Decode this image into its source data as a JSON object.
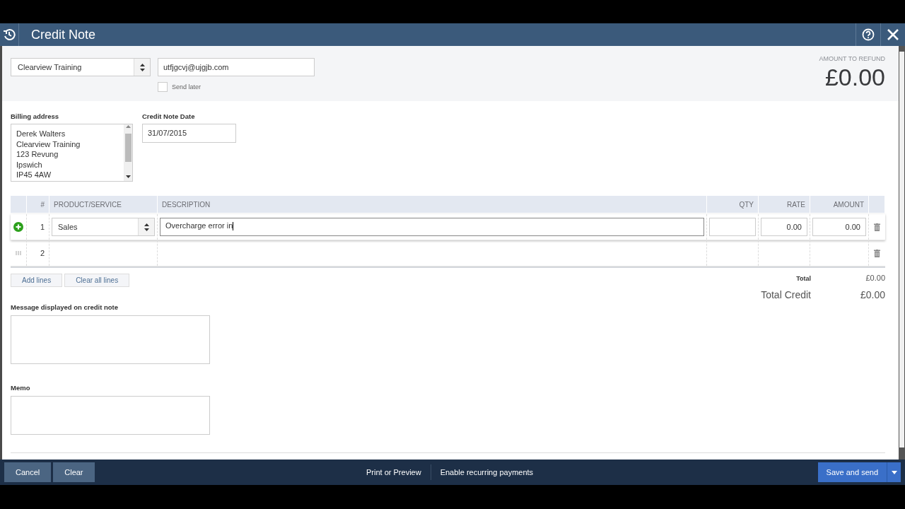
{
  "window": {
    "title": "Credit Note"
  },
  "customer": {
    "value": "Clearview Training"
  },
  "email": {
    "value": "utfjgcvj@ujgjb.com"
  },
  "send_later": {
    "label": "Send later",
    "checked": false
  },
  "amount_to_refund": {
    "label": "AMOUNT TO REFUND",
    "value": "£0.00"
  },
  "billing_address": {
    "label": "Billing address",
    "lines": [
      "Derek Walters",
      "Clearview Training",
      "123 Revung",
      "Ipswich",
      "IP45 4AW"
    ]
  },
  "credit_note_date": {
    "label": "Credit Note Date",
    "value": "31/07/2015"
  },
  "table": {
    "columns": [
      "#",
      "PRODUCT/SERVICE",
      "DESCRIPTION",
      "QTY",
      "RATE",
      "AMOUNT"
    ],
    "rows": [
      {
        "number": "1",
        "editing": true,
        "product": "Sales",
        "description": "Overcharge error in",
        "rate": "0.00",
        "amount": "0.00"
      },
      {
        "number": "2",
        "editing": false
      }
    ]
  },
  "line_buttons": [
    "Add lines",
    "Clear all lines"
  ],
  "totals": {
    "total_label": "Total",
    "total": "£0.00",
    "credit_label": "Total Credit",
    "credit": "£0.00"
  },
  "message": {
    "label": "Message displayed on credit note"
  },
  "memo": {
    "label": "Memo"
  },
  "footer": {
    "left_buttons": [
      "Cancel",
      "Clear"
    ],
    "links": [
      "Print or Preview",
      "Enable recurring payments"
    ],
    "primary": "Save and send"
  }
}
